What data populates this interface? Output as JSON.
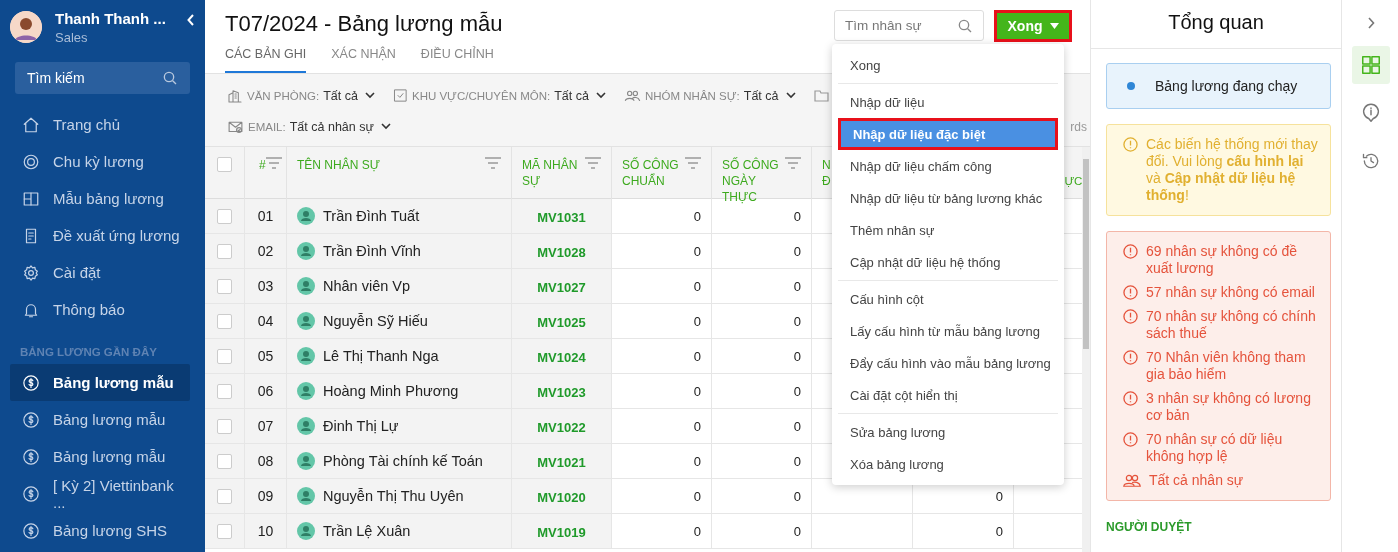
{
  "sidebar": {
    "user": {
      "name": "Thanh Thanh ...",
      "role": "Sales"
    },
    "search": {
      "placeholder": "Tìm kiếm"
    },
    "nav": [
      {
        "label": "Trang chủ"
      },
      {
        "label": "Chu kỳ lương"
      },
      {
        "label": "Mẫu bảng lương"
      },
      {
        "label": "Đề xuất ứng lương"
      },
      {
        "label": "Cài đặt"
      },
      {
        "label": "Thông báo"
      }
    ],
    "recent_title": "BẢNG LƯƠNG GẦN ĐÂY",
    "recent": [
      {
        "label": "Bảng lương mẫu",
        "selected": true
      },
      {
        "label": "Bảng lương mẫu",
        "selected": false
      },
      {
        "label": "Bảng lương mẫu",
        "selected": false
      },
      {
        "label": "[ Kỳ 2] Viettinbank ...",
        "selected": false
      },
      {
        "label": "Bảng lương SHS",
        "selected": false
      }
    ]
  },
  "page": {
    "title": "T07/2024 - Bảng lương mẫu",
    "tabs": [
      {
        "label": "CÁC BẢN GHI",
        "selected": true
      },
      {
        "label": "XÁC NHẬN",
        "selected": false
      },
      {
        "label": "ĐIỀU CHỈNH",
        "selected": false
      }
    ],
    "search": {
      "placeholder": "Tìm nhân sự"
    },
    "done_button": {
      "label": "Xong",
      "highlighted": true
    },
    "filters": [
      {
        "label": "VĂN PHÒNG:",
        "value": "Tất cả"
      },
      {
        "label": "KHU VỰC/CHUYÊN MÔN:",
        "value": "Tất cả"
      },
      {
        "label": "NHÓM NHÂN SỰ:",
        "value": "Tất cả"
      },
      {
        "label": "EMAIL:",
        "value": "Tất cả nhân sự"
      }
    ],
    "filter_tail": "rds"
  },
  "table": {
    "columns": [
      {
        "label": "#",
        "filter": true
      },
      {
        "label": "TÊN NHÂN SỰ",
        "filter": true
      },
      {
        "label": "MÃ NHÂN\nSỰ",
        "filter": true
      },
      {
        "label": "SỐ CÔNG\nCHUẨN",
        "filter": true
      },
      {
        "label": "SỐ CÔNG\nNGÀY THỰC",
        "filter": true
      },
      {
        "label": "N\nĐ",
        "filter": false
      },
      {
        "label": "\nỰC",
        "filter": false
      }
    ],
    "all_checked": false,
    "rows": [
      {
        "checked": false,
        "number": "01",
        "name": "Trần Đình Tuất",
        "code": "MV1031",
        "standard": "0",
        "actual": "0"
      },
      {
        "checked": false,
        "number": "02",
        "name": "Trần Đình Vĩnh",
        "code": "MV1028",
        "standard": "0",
        "actual": "0"
      },
      {
        "checked": false,
        "number": "03",
        "name": "Nhân viên Vp",
        "code": "MV1027",
        "standard": "0",
        "actual": "0"
      },
      {
        "checked": false,
        "number": "04",
        "name": "Nguyễn Sỹ Hiếu",
        "code": "MV1025",
        "standard": "0",
        "actual": "0"
      },
      {
        "checked": false,
        "number": "05",
        "name": "Lê Thị Thanh Nga",
        "code": "MV1024",
        "standard": "0",
        "actual": "0"
      },
      {
        "checked": false,
        "number": "06",
        "name": "Hoàng Minh Phương",
        "code": "MV1023",
        "standard": "0",
        "actual": "0"
      },
      {
        "checked": false,
        "number": "07",
        "name": "Đinh Thị Lự",
        "code": "MV1022",
        "standard": "0",
        "actual": "0"
      },
      {
        "checked": false,
        "number": "08",
        "name": "Phòng Tài chính kế Toán",
        "code": "MV1021",
        "standard": "0",
        "actual": "0"
      },
      {
        "checked": false,
        "number": "09",
        "name": "Nguyễn Thị Thu Uyên",
        "code": "MV1020",
        "standard": "0",
        "actual": "0",
        "column_7": "0"
      },
      {
        "checked": false,
        "number": "10",
        "name": "Trần Lệ Xuân",
        "code": "MV1019",
        "standard": "0",
        "actual": "0",
        "column_7": "0"
      }
    ]
  },
  "menu": {
    "groups": [
      {
        "items": [
          {
            "label": "Xong",
            "selected": false
          }
        ]
      },
      {
        "items": [
          {
            "label": "Nhập dữ liệu",
            "selected": false
          },
          {
            "label": "Nhập dữ liệu đặc biệt",
            "selected": true
          },
          {
            "label": "Nhập dữ liệu chấm công",
            "selected": false
          },
          {
            "label": "Nhập dữ liệu từ bảng lương khác",
            "selected": false
          },
          {
            "label": "Thêm nhân sự",
            "selected": false
          },
          {
            "label": "Cập nhật dữ liệu hệ thống",
            "selected": false
          }
        ]
      },
      {
        "items": [
          {
            "label": "Cấu hình cột",
            "selected": false
          },
          {
            "label": "Lấy cấu hình từ mẫu bảng lương",
            "selected": false
          },
          {
            "label": "Đẩy cấu hình vào mẫu bảng lương",
            "selected": false
          },
          {
            "label": "Cài đặt cột hiển thị",
            "selected": false
          }
        ]
      },
      {
        "items": [
          {
            "label": "Sửa bảng lương",
            "selected": false
          },
          {
            "label": "Xóa bảng lương",
            "selected": false
          }
        ]
      }
    ]
  },
  "overview": {
    "title": "Tổng quan",
    "status": {
      "label": "Bảng lương đang chạy",
      "color": "#2f86d6"
    },
    "warning": "Các biến hệ thống mới thay đổi. Vui lòng **cấu hình lại** và **Cập nhật dữ liệu hệ thống**!",
    "issues": [
      "69 nhân sự không có đề xuất lương",
      "57 nhân sự không có email",
      "70 nhân sự không có chính sách thuế",
      "70 Nhân viên không tham gia bảo hiểm",
      "3 nhân sự không có lương cơ bản",
      "70 nhân sự có dữ liệu không hợp lệ"
    ],
    "all_staff": "Tất cả nhân sự",
    "approvers_title": "NGƯỜI DUYỆT"
  },
  "rail": {
    "tabs": [
      {
        "selected": true
      },
      {
        "selected": false
      },
      {
        "selected": false
      }
    ]
  }
}
